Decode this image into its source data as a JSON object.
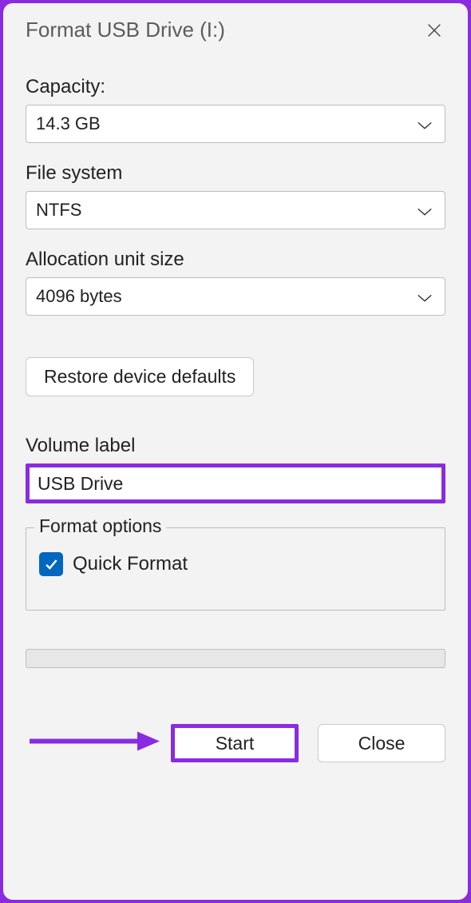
{
  "window": {
    "title": "Format USB Drive (I:)"
  },
  "capacity": {
    "label": "Capacity:",
    "value": "14.3 GB"
  },
  "file_system": {
    "label": "File system",
    "value": "NTFS"
  },
  "allocation": {
    "label": "Allocation unit size",
    "value": "4096 bytes"
  },
  "restore": {
    "label": "Restore device defaults"
  },
  "volume_label": {
    "label": "Volume label",
    "value": "USB Drive"
  },
  "format_options": {
    "legend": "Format options",
    "quick_format_label": "Quick Format",
    "quick_format_checked": true
  },
  "buttons": {
    "start": "Start",
    "close": "Close"
  }
}
